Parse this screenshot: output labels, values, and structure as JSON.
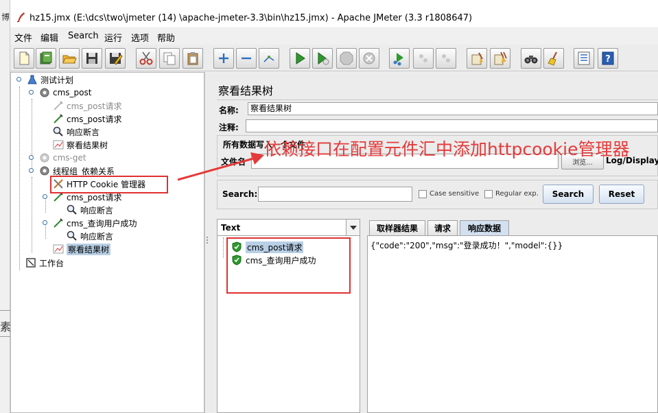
{
  "window": {
    "title": "hz15.jmx (E:\\dcs\\two\\jmeter  (14)  \\apache-jmeter-3.3\\bin\\hz15.jmx) - Apache JMeter (3.3 r1808647)"
  },
  "background": {
    "left_char_top": "博",
    "left_char_bottom": "素"
  },
  "menu": {
    "items": [
      "文件",
      "编辑",
      "Search",
      "运行",
      "选项",
      "帮助"
    ]
  },
  "toolbar": {
    "buttons": [
      "new-icon",
      "templates-icon",
      "open-icon",
      "save-icon",
      "save-as-icon",
      "cut-icon",
      "copy-icon",
      "paste-icon",
      "expand-icon",
      "collapse-icon",
      "toggle-icon",
      "start-icon",
      "start-no-pause-icon",
      "stop-icon",
      "shutdown-icon",
      "remote-start-icon",
      "remote-stop-icon",
      "remote-shutdown-icon",
      "clear-icon",
      "clear-all-icon",
      "search-icon",
      "reset-search-icon",
      "function-helper-icon",
      "help-icon"
    ]
  },
  "tree": {
    "nodes": [
      {
        "label": "测试计划",
        "icon": "test-plan-icon"
      },
      {
        "label": "cms_post",
        "icon": "thread-group-icon"
      },
      {
        "label": "cms_post请求",
        "icon": "sampler-icon",
        "disabled": true
      },
      {
        "label": "cms_post请求",
        "icon": "sampler-icon"
      },
      {
        "label": "响应断言",
        "icon": "assertion-icon"
      },
      {
        "label": "察看结果树",
        "icon": "listener-icon"
      },
      {
        "label": "cms-get",
        "icon": "thread-group-icon",
        "disabled": true
      },
      {
        "label": "线程组_依赖关系",
        "icon": "thread-group-icon"
      },
      {
        "label": "HTTP Cookie 管理器",
        "icon": "config-element-icon"
      },
      {
        "label": "cms_post请求",
        "icon": "sampler-icon"
      },
      {
        "label": "响应断言",
        "icon": "assertion-icon"
      },
      {
        "label": "cms_查询用户成功",
        "icon": "sampler-icon"
      },
      {
        "label": "响应断言",
        "icon": "assertion-icon"
      },
      {
        "label": "察看结果树",
        "icon": "listener-icon",
        "selected": true
      },
      {
        "label": "工作台",
        "icon": "workbench-icon"
      }
    ]
  },
  "panel": {
    "title": "察看结果树",
    "name_label": "名称:",
    "name_value": "察看结果树",
    "comment_label": "注释:",
    "comment_value": "",
    "write_all_label": "所有数据写入一个文件",
    "filename_label": "文件名",
    "filename_value": "",
    "browse_label": "浏览...",
    "log_display_label": "Log/Display O"
  },
  "search": {
    "label": "Search:",
    "value": "",
    "case_sensitive_label": "Case sensitive",
    "case_sensitive_checked": false,
    "regex_label": "Regular exp.",
    "regex_checked": false,
    "search_button": "Search",
    "reset_button": "Reset"
  },
  "results": {
    "renderer": "Text",
    "items": [
      {
        "label": "cms_post请求",
        "status": "success",
        "selected": true
      },
      {
        "label": "cms_查询用户成功",
        "status": "success"
      }
    ],
    "tabs": [
      "取样器结果",
      "请求",
      "响应数据"
    ],
    "active_tab": 2,
    "response_body": "{\"code\":\"200\",\"msg\":\"登录成功！\",\"model\":{}}"
  },
  "annotation": {
    "text": "依赖接口在配置元件汇中添加httpcookie管理器",
    "color": "#e53a3a"
  }
}
